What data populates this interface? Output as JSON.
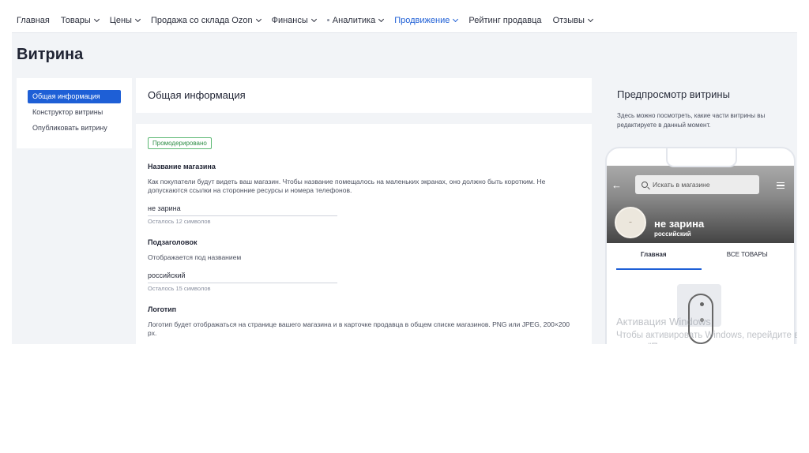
{
  "nav": {
    "items": [
      {
        "label": "Главная",
        "chevron": false,
        "dot": false,
        "active": false
      },
      {
        "label": "Товары",
        "chevron": true,
        "dot": false,
        "active": false
      },
      {
        "label": "Цены",
        "chevron": true,
        "dot": false,
        "active": false
      },
      {
        "label": "Продажа со склада Ozon",
        "chevron": true,
        "dot": false,
        "active": false
      },
      {
        "label": "Финансы",
        "chevron": true,
        "dot": false,
        "active": false
      },
      {
        "label": "Аналитика",
        "chevron": true,
        "dot": true,
        "active": false
      },
      {
        "label": "Продвижение",
        "chevron": true,
        "dot": false,
        "active": true
      },
      {
        "label": "Рейтинг продавца",
        "chevron": false,
        "dot": false,
        "active": false
      },
      {
        "label": "Отзывы",
        "chevron": true,
        "dot": false,
        "active": false
      }
    ]
  },
  "page": {
    "title": "Витрина"
  },
  "sidebar": {
    "items": [
      {
        "label": "Общая информация",
        "active": true
      },
      {
        "label": "Конструктор витрины",
        "active": false
      },
      {
        "label": "Опубликовать витрину",
        "active": false
      }
    ]
  },
  "main": {
    "section_title": "Общая информация",
    "status_badge": "Промодерировано",
    "name_field": {
      "title": "Название магазина",
      "description": "Как покупатели будут видеть ваш магазин. Чтобы название помещалось на маленьких экранах, оно должно быть коротким. Не допускаются ссылки на сторонние ресурсы и номера телефонов.",
      "value": "не зарина",
      "hint": "Осталось 12 символов"
    },
    "subtitle_field": {
      "title": "Подзаголовок",
      "description": "Отображается под названием",
      "value": "российский",
      "hint": "Осталось 15 символов"
    },
    "logo_field": {
      "title": "Логотип",
      "description": "Логотип будет отображаться на странице вашего магазина и в карточке продавца в общем списке магазинов. PNG или JPEG, 200×200 px."
    }
  },
  "preview": {
    "title": "Предпросмотр витрины",
    "description": "Здесь можно посмотреть, какие части витрины вы редактируете в данный момент.",
    "phone": {
      "search_placeholder": "Искать в магазине",
      "shop_name": "не зарина",
      "shop_subtitle": "российский",
      "tabs": [
        {
          "label": "Главная",
          "active": true
        },
        {
          "label": "ВСЕ ТОВАРЫ",
          "active": false
        }
      ]
    }
  },
  "watermark": {
    "title": "Активация Windows",
    "subtitle": "Чтобы активировать Windows, перейдите в раздел \"Параметры\"."
  },
  "colors": {
    "accent": "#1e5fd6",
    "badge_green": "#2f8d46"
  }
}
